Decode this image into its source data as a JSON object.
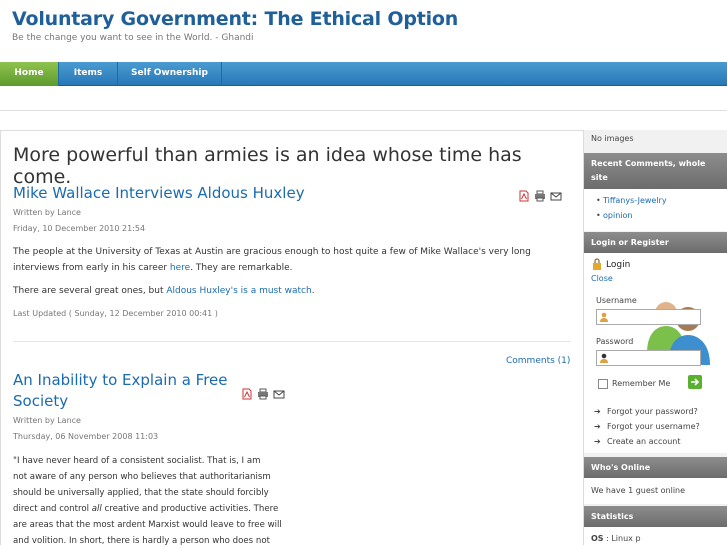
{
  "site": {
    "title": "Voluntary Government: The Ethical Option",
    "tagline": "Be the change you want to see in the World. - Ghandi"
  },
  "nav": {
    "home": "Home",
    "items": "Items",
    "self_ownership": "Self Ownership"
  },
  "main": {
    "quote_heading": "More powerful than armies is an idea whose time has come.",
    "article1": {
      "title": "Mike Wallace Interviews Aldous Huxley",
      "author": "Written by Lance",
      "date": "Friday, 10 December 2010 21:54",
      "para1_a": "The people at the University of Texas at Austin are gracious enough to host quite a few of Mike Wallace's very long",
      "para1_b": "interviews from early in his career ",
      "para1_link": "here",
      "para1_c": ". They are remarkable.",
      "para2_a": "There are several great ones, but ",
      "para2_link": "Aldous Huxley's is a must watch",
      "para2_b": ".",
      "updated": "Last Updated ( Sunday, 12 December 2010 00:41 )",
      "comments": "Comments (1)"
    },
    "article2": {
      "title_line1": "An Inability to Explain a Free",
      "title_line2": "Society",
      "author": "Written by Lance",
      "date": "Thursday, 06 November 2008 11:03",
      "lines": [
        "\"I have never heard of a consistent socialist.  That is, I am",
        "not aware of any person who believes that authoritarianism",
        "should be universally applied, that the state should forcibly",
        "direct and control ",
        "are areas that the most ardent Marxist would leave to free will",
        "and volition.  In short, there is hardly a person who does not"
      ],
      "line4_em": "all",
      "line4_rest": " creative and productive activities.  There"
    }
  },
  "sidebar": {
    "no_images": "No images",
    "recent_comments_head": "Recent Comments, whole site",
    "recent_comments": [
      "Tiffanys-Jewelry",
      "opinion"
    ],
    "login_head": "Login or Register",
    "login_label": "Login",
    "close_label": "Close",
    "username_label": "Username",
    "password_label": "Password",
    "remember_label": "Remember Me",
    "links": [
      "Forgot your password?",
      "Forgot your username?",
      "Create an account"
    ],
    "whos_online_head": "Who's Online",
    "whos_online_text": "We have 1 guest online",
    "statistics_head": "Statistics",
    "os_label": "OS",
    "os_value": " : Linux p"
  }
}
